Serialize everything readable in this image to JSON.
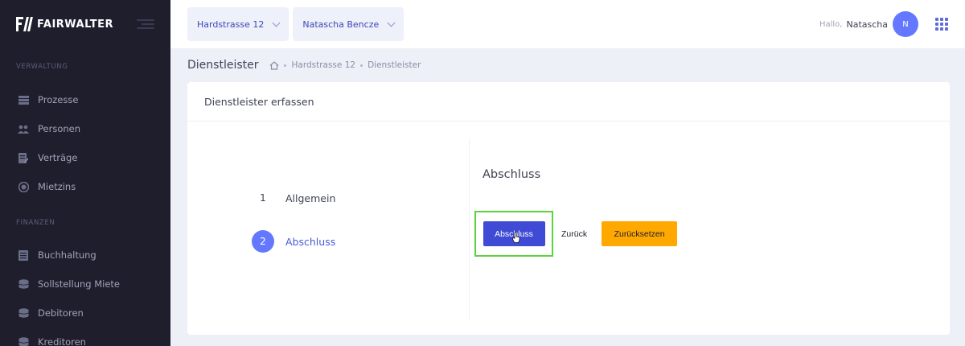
{
  "brand": {
    "name": "FAIRWALTER"
  },
  "sidebar": {
    "sections": [
      {
        "title": "VERWALTUNG",
        "items": [
          {
            "label": "Prozesse",
            "icon": "list-icon"
          },
          {
            "label": "Personen",
            "icon": "people-icon"
          },
          {
            "label": "Verträge",
            "icon": "contract-icon"
          },
          {
            "label": "Mietzins",
            "icon": "coin-icon"
          }
        ]
      },
      {
        "title": "FINANZEN",
        "items": [
          {
            "label": "Buchhaltung",
            "icon": "ledger-icon"
          },
          {
            "label": "Sollstellung Miete",
            "icon": "coins-stack-icon"
          },
          {
            "label": "Debitoren",
            "icon": "coins-stack-icon"
          },
          {
            "label": "Kreditoren",
            "icon": "coins-stack-icon"
          }
        ]
      }
    ]
  },
  "header": {
    "property_select": "Hardstrasse 12",
    "person_select": "Natascha Bencze",
    "greeting": "Hallo,",
    "user_name": "Natascha",
    "avatar_initial": "N"
  },
  "subheader": {
    "title": "Dienstleister",
    "breadcrumb": [
      "Hardstrasse 12",
      "Dienstleister"
    ]
  },
  "card": {
    "title": "Dienstleister erfassen",
    "steps": [
      {
        "number": "1",
        "label": "Allgemein",
        "active": false
      },
      {
        "number": "2",
        "label": "Abschluss",
        "active": true
      }
    ],
    "section_heading": "Abschluss",
    "buttons": {
      "submit": "Abschluss",
      "back": "Zurück",
      "reset": "Zurücksetzen"
    }
  },
  "colors": {
    "sidebar_bg": "#1e1e2d",
    "primary": "#3f4bd4",
    "accent": "#6478ff",
    "warning": "#ffa800",
    "highlight": "#5bd33a"
  }
}
